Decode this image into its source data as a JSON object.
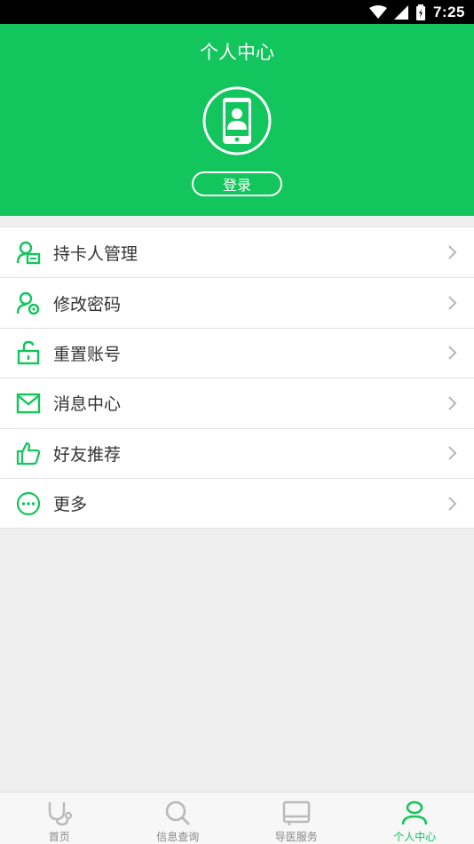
{
  "status_bar": {
    "time": "7:25"
  },
  "header": {
    "title": "个人中心",
    "login_label": "登录"
  },
  "menu": {
    "items": [
      {
        "label": "持卡人管理",
        "icon": "card-holder-icon"
      },
      {
        "label": "修改密码",
        "icon": "user-settings-icon"
      },
      {
        "label": "重置账号",
        "icon": "unlock-icon"
      },
      {
        "label": "消息中心",
        "icon": "mail-icon"
      },
      {
        "label": "好友推荐",
        "icon": "thumbs-up-icon"
      },
      {
        "label": "更多",
        "icon": "more-icon"
      }
    ]
  },
  "tabbar": {
    "tabs": [
      {
        "label": "首页",
        "icon": "stethoscope-icon",
        "active": false
      },
      {
        "label": "信息查询",
        "icon": "search-icon",
        "active": false
      },
      {
        "label": "导医服务",
        "icon": "guide-icon",
        "active": false
      },
      {
        "label": "个人中心",
        "icon": "person-icon",
        "active": true
      }
    ]
  },
  "colors": {
    "brand_green": "#12c55c",
    "background": "#efefef",
    "tab_inactive": "#888888"
  }
}
